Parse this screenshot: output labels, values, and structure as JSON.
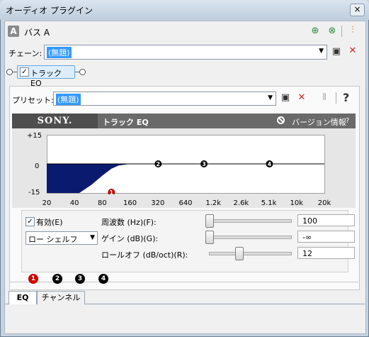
{
  "window": {
    "title": "オーディオ プラグイン",
    "close_glyph": "×"
  },
  "bus": {
    "icon_letter": "A",
    "label": "バス A"
  },
  "chain": {
    "label": "チェーン:",
    "value": "(無題)"
  },
  "plugin_node": {
    "label": "トラック EQ",
    "checked": true
  },
  "preset": {
    "label": "プリセット:",
    "value": "(無題)",
    "help": "?"
  },
  "header": {
    "logo": "SONY.",
    "title": "トラック EQ",
    "version_info": "バージョン情報",
    "help": "?"
  },
  "chart_data": {
    "type": "line",
    "title": "",
    "xlabel": "",
    "ylabel": "",
    "x_scale": "log",
    "x_ticks": [
      "20",
      "40",
      "80",
      "160",
      "320",
      "640",
      "1.2k",
      "2.6k",
      "5.1k",
      "10k",
      "20k"
    ],
    "y_ticks": [
      "+15",
      "0",
      "-15"
    ],
    "ylim": [
      -15,
      15
    ],
    "xlim": [
      20,
      20000
    ],
    "series": [
      {
        "x": [
          20,
          30,
          45,
          60,
          80,
          100,
          120,
          160,
          20000
        ],
        "y": [
          -15,
          -15,
          -15,
          -11,
          -6,
          -2.5,
          -0.8,
          0,
          0
        ]
      }
    ],
    "band_markers": [
      {
        "label": "1",
        "x": 100,
        "y": -15,
        "color": "#c00000"
      },
      {
        "label": "2",
        "x": 320,
        "y": 0,
        "color": "#000000"
      },
      {
        "label": "3",
        "x": 1000,
        "y": 0,
        "color": "#000000"
      },
      {
        "label": "4",
        "x": 5100,
        "y": 0,
        "color": "#000000"
      }
    ],
    "fill_color": "#0a1a6e"
  },
  "controls": {
    "enable": {
      "label": "有効(E)",
      "checked": true
    },
    "filter_type": "ロー シェルフ",
    "frequency": {
      "label": "周波数 (Hz)(F):",
      "value": "100",
      "position": 0.0
    },
    "gain": {
      "label": "ゲイン (dB)(G):",
      "value": "-∞",
      "position": 0.0
    },
    "rolloff": {
      "label": "ロールオフ (dB/oct)(R):",
      "value": "12",
      "position": 0.35
    }
  },
  "band_tabs": [
    "1",
    "2",
    "3",
    "4"
  ],
  "bottom_tabs": [
    "EQ",
    "チャンネル"
  ]
}
